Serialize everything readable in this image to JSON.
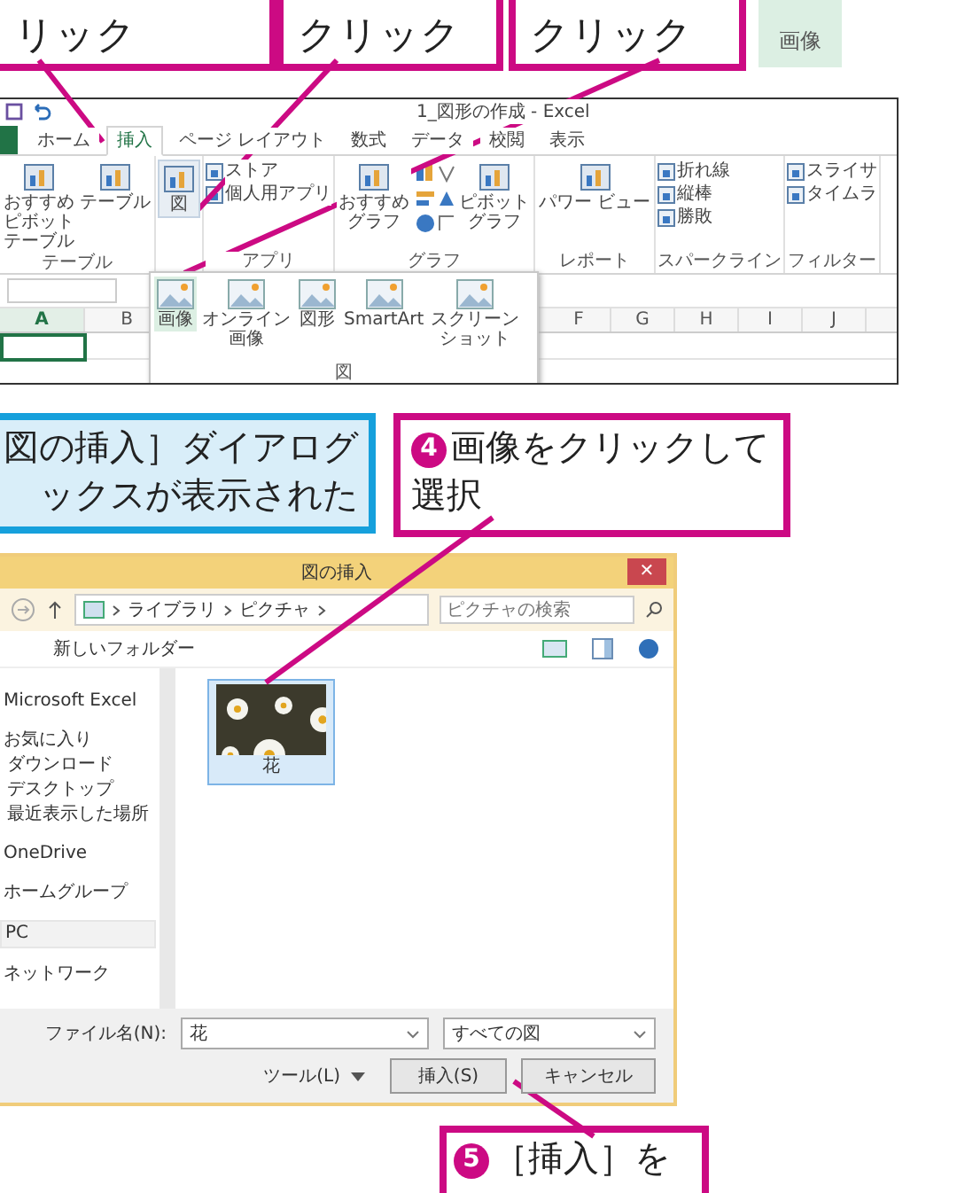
{
  "top_callouts": [
    {
      "text": "リック"
    },
    {
      "text": "クリック"
    },
    {
      "text": "クリック"
    }
  ],
  "corner_tile": {
    "label": "画像"
  },
  "excel": {
    "title": "1_図形の作成 - Excel",
    "tabs": [
      {
        "label": "ホーム",
        "selected": false
      },
      {
        "label": "挿入",
        "selected": true
      },
      {
        "label": "ページ レイアウト",
        "selected": false
      },
      {
        "label": "数式",
        "selected": false
      },
      {
        "label": "データ",
        "selected": false
      },
      {
        "label": "校閲",
        "selected": false
      },
      {
        "label": "表示",
        "selected": false
      }
    ],
    "ribbon_groups": [
      {
        "label": "テーブル",
        "items": [
          {
            "kind": "large",
            "label": "おすすめピボットテーブル",
            "pressed": false
          },
          {
            "kind": "large",
            "label": "テーブル",
            "pressed": false
          }
        ]
      },
      {
        "items": [
          {
            "kind": "large",
            "label": "図",
            "pressed": true
          }
        ]
      },
      {
        "label": "アプリ",
        "items": [
          {
            "kind": "small",
            "label": "ストア"
          },
          {
            "kind": "small",
            "label": "個人用アプリ"
          }
        ]
      },
      {
        "label": "グラフ",
        "items": [
          {
            "kind": "large",
            "label": "おすすめグラフ",
            "pressed": false
          },
          {
            "kind": "icons"
          },
          {
            "kind": "large",
            "label": "ピボットグラフ",
            "pressed": false
          }
        ]
      },
      {
        "label": "レポート",
        "items": [
          {
            "kind": "large",
            "label": "パワー ビュー",
            "pressed": false
          }
        ]
      },
      {
        "label": "スパークライン",
        "items": [
          {
            "kind": "small",
            "label": "折れ線"
          },
          {
            "kind": "small",
            "label": "縦棒"
          },
          {
            "kind": "small",
            "label": "勝敗"
          }
        ]
      },
      {
        "label": "フィルター",
        "items": [
          {
            "kind": "small",
            "label": "スライサ"
          },
          {
            "kind": "small",
            "label": "タイムラ"
          }
        ]
      }
    ],
    "picture_menu": {
      "label": "図",
      "items": [
        {
          "label": "画像",
          "selected": true
        },
        {
          "label": "オンライン画像",
          "selected": false
        },
        {
          "label": "図形",
          "selected": false
        },
        {
          "label": "SmartArt",
          "selected": false
        },
        {
          "label": "スクリーンショット",
          "selected": false
        }
      ]
    },
    "columns": [
      {
        "label": "A",
        "selected": true
      },
      {
        "label": "B",
        "selected": false
      },
      {
        "label": "F",
        "selected": false
      },
      {
        "label": "G",
        "selected": false
      },
      {
        "label": "H",
        "selected": false
      },
      {
        "label": "I",
        "selected": false
      },
      {
        "label": "J",
        "selected": false
      }
    ]
  },
  "info_callout": {
    "lines": [
      "図の挿入］ダイアログ",
      "ックスが表示された"
    ]
  },
  "step_callouts": [
    {
      "step": "4",
      "text": "画像をクリックして選択"
    }
  ],
  "dialog": {
    "title": "図の挿入",
    "close": "✕",
    "path": [
      "ライブラリ",
      "ピクチャ"
    ],
    "search": {
      "placeholder": "ピクチャの検索"
    },
    "new_folder": "新しいフォルダー",
    "nav": [
      {
        "kind": "header",
        "label": "Microsoft Excel",
        "selected": false
      },
      {
        "kind": "header",
        "label": "お気に入り",
        "selected": false
      },
      {
        "kind": "item",
        "label": "ダウンロード",
        "selected": false
      },
      {
        "kind": "item",
        "label": "デスクトップ",
        "selected": false
      },
      {
        "kind": "item",
        "label": "最近表示した場所",
        "selected": false
      },
      {
        "kind": "header",
        "label": "OneDrive",
        "selected": false
      },
      {
        "kind": "header",
        "label": "ホームグループ",
        "selected": false
      },
      {
        "kind": "header",
        "label": "PC",
        "selected": true
      },
      {
        "kind": "header",
        "label": "ネットワーク",
        "selected": false
      }
    ],
    "files": [
      {
        "name": "花",
        "selected": true,
        "kind": "picture"
      }
    ],
    "filename_label": "ファイル名(N):",
    "filename": "花",
    "filter": "すべての図",
    "tools": "ツール(L)",
    "buttons": [
      "挿入(S)",
      "キャンセル"
    ]
  },
  "bottom_callout": {
    "step": "5",
    "text": "［挿入］を"
  }
}
